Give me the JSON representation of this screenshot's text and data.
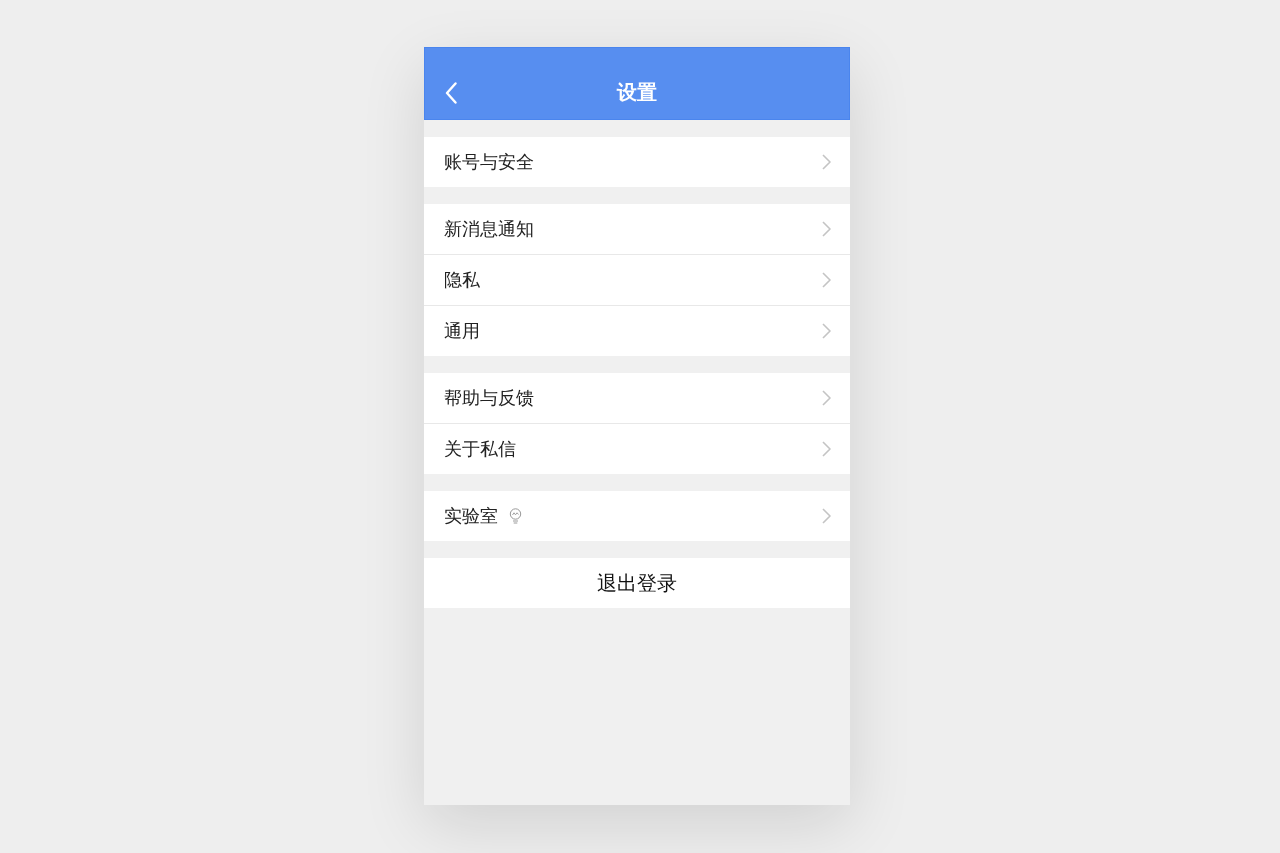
{
  "header": {
    "title": "设置"
  },
  "groups": [
    {
      "items": [
        {
          "label": "账号与安全",
          "kind": "plain"
        }
      ]
    },
    {
      "items": [
        {
          "label": "新消息通知",
          "kind": "plain"
        },
        {
          "label": "隐私",
          "kind": "plain"
        },
        {
          "label": "通用",
          "kind": "plain"
        }
      ]
    },
    {
      "items": [
        {
          "label": "帮助与反馈",
          "kind": "plain"
        },
        {
          "label": "关于私信",
          "kind": "plain"
        }
      ]
    },
    {
      "items": [
        {
          "label": "实验室",
          "kind": "lab"
        }
      ]
    }
  ],
  "logout_button": {
    "label": "退出登录"
  }
}
